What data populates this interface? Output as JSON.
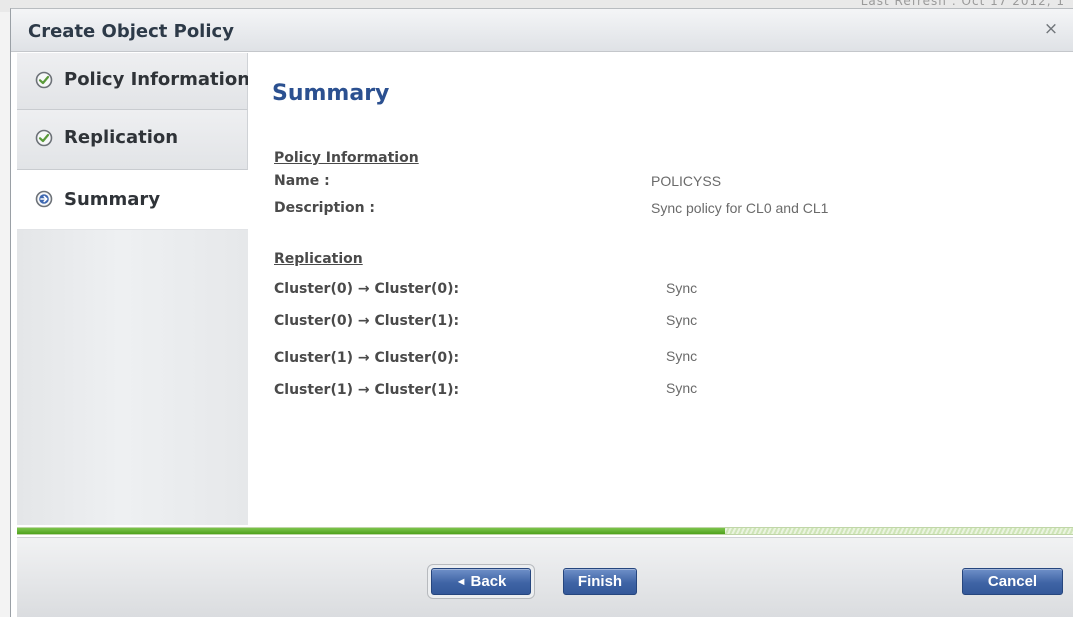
{
  "dialog": {
    "title": "Create Object Policy",
    "close_glyph": "×"
  },
  "background": {
    "text": "Last Refresh : Oct 17 2012, 1"
  },
  "sidebar": {
    "items": [
      {
        "label": "Policy Information",
        "icon": "check-circle-icon",
        "state": "completed"
      },
      {
        "label": "Replication",
        "icon": "check-circle-icon",
        "state": "completed"
      },
      {
        "label": "Summary",
        "icon": "arrow-right-circle-icon",
        "state": "current"
      }
    ]
  },
  "main": {
    "title": "Summary",
    "policy_information": {
      "heading": "Policy Information",
      "name_label": "Name :",
      "name_value": "POLICYSS",
      "description_label": "Description :",
      "description_value": "Sync policy for CL0 and CL1"
    },
    "replication": {
      "heading": "Replication",
      "rows": [
        {
          "label": "Cluster(0) → Cluster(0):",
          "value": "Sync"
        },
        {
          "label": "Cluster(0) → Cluster(1):",
          "value": "Sync"
        },
        {
          "label": "Cluster(1) → Cluster(0):",
          "value": "Sync"
        },
        {
          "label": "Cluster(1) → Cluster(1):",
          "value": "Sync"
        }
      ]
    }
  },
  "progress": {
    "fraction": 0.67
  },
  "footer": {
    "back_label": "Back",
    "back_glyph": "◄",
    "finish_label": "Finish",
    "cancel_label": "Cancel"
  },
  "colors": {
    "accent": "#3f64a5",
    "title_blue": "#2b5090",
    "progress_green": "#4ea21c",
    "check_green": "#5a9a3a"
  }
}
